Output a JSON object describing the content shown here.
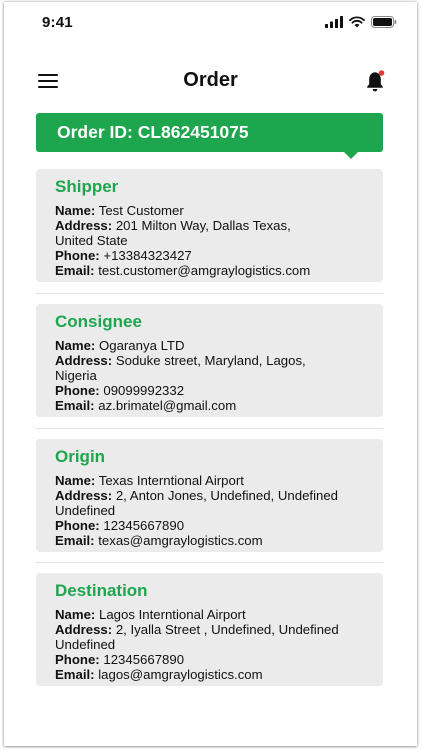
{
  "status_bar": {
    "time": "9:41"
  },
  "header": {
    "title": "Order"
  },
  "order": {
    "id_text": "Order ID: CL862451075"
  },
  "colors": {
    "accent": "#1da64e",
    "card_bg": "#ebebeb",
    "badge": "#e53935"
  },
  "icons": [
    "menu-icon",
    "bell-icon",
    "signal-icon",
    "wifi-icon",
    "battery-icon"
  ],
  "labels": {
    "name": "Name:",
    "address": "Address:",
    "phone": "Phone:",
    "email": "Email:"
  },
  "shipper": {
    "title": "Shipper",
    "name": "Test Customer",
    "address_line1": "201 Milton Way, Dallas Texas,",
    "address_line2": "United State",
    "phone": "+13384323427",
    "email": "test.customer@amgraylogistics.com"
  },
  "consignee": {
    "title": "Consignee",
    "name": "Ogaranya LTD",
    "address_line1": "Soduke street, Maryland, Lagos,",
    "address_line2": "Nigeria",
    "phone": "09099992332",
    "email": "az.brimatel@gmail.com"
  },
  "origin": {
    "title": "Origin",
    "name": "Texas Interntional Airport",
    "address_line1": "2, Anton Jones, Undefined, Undefined",
    "address_line2": "Undefined",
    "phone": "12345667890",
    "email": "texas@amgraylogistics.com"
  },
  "destination": {
    "title": "Destination",
    "name": "Lagos Interntional Airport",
    "address_line1": "2, Iyalla Street , Undefined, Undefined",
    "address_line2": "Undefined",
    "phone": "12345667890",
    "email": "lagos@amgraylogistics.com"
  }
}
